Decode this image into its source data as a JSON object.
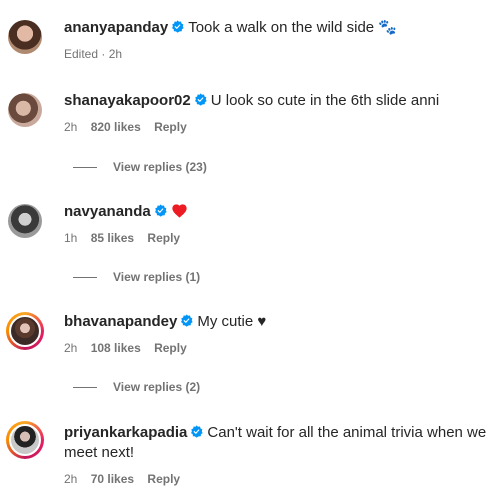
{
  "comments": [
    {
      "username": "ananyapanday",
      "text": "Took a walk on the wild side 🐾",
      "time": "Edited · 2h"
    },
    {
      "username": "shanayakapoor02",
      "text": "U look so cute in the 6th slide anni",
      "time": "2h",
      "likes": "820 likes",
      "reply": "Reply",
      "view_replies": "View replies (23)"
    },
    {
      "username": "navyananda",
      "text": "",
      "emoji": "red-heart",
      "time": "1h",
      "likes": "85 likes",
      "reply": "Reply",
      "view_replies": "View replies (1)"
    },
    {
      "username": "bhavanapandey",
      "text": "My cutie ♥",
      "time": "2h",
      "likes": "108 likes",
      "reply": "Reply",
      "view_replies": "View replies (2)"
    },
    {
      "username": "priyankarkapadia",
      "text": "Can't wait for all the animal trivia when we meet next!",
      "time": "2h",
      "likes": "70 likes",
      "reply": "Reply"
    }
  ],
  "colors": {
    "verified_blue": "#0095f6",
    "heart_red": "#ed1c24",
    "muted_text": "#737373"
  }
}
